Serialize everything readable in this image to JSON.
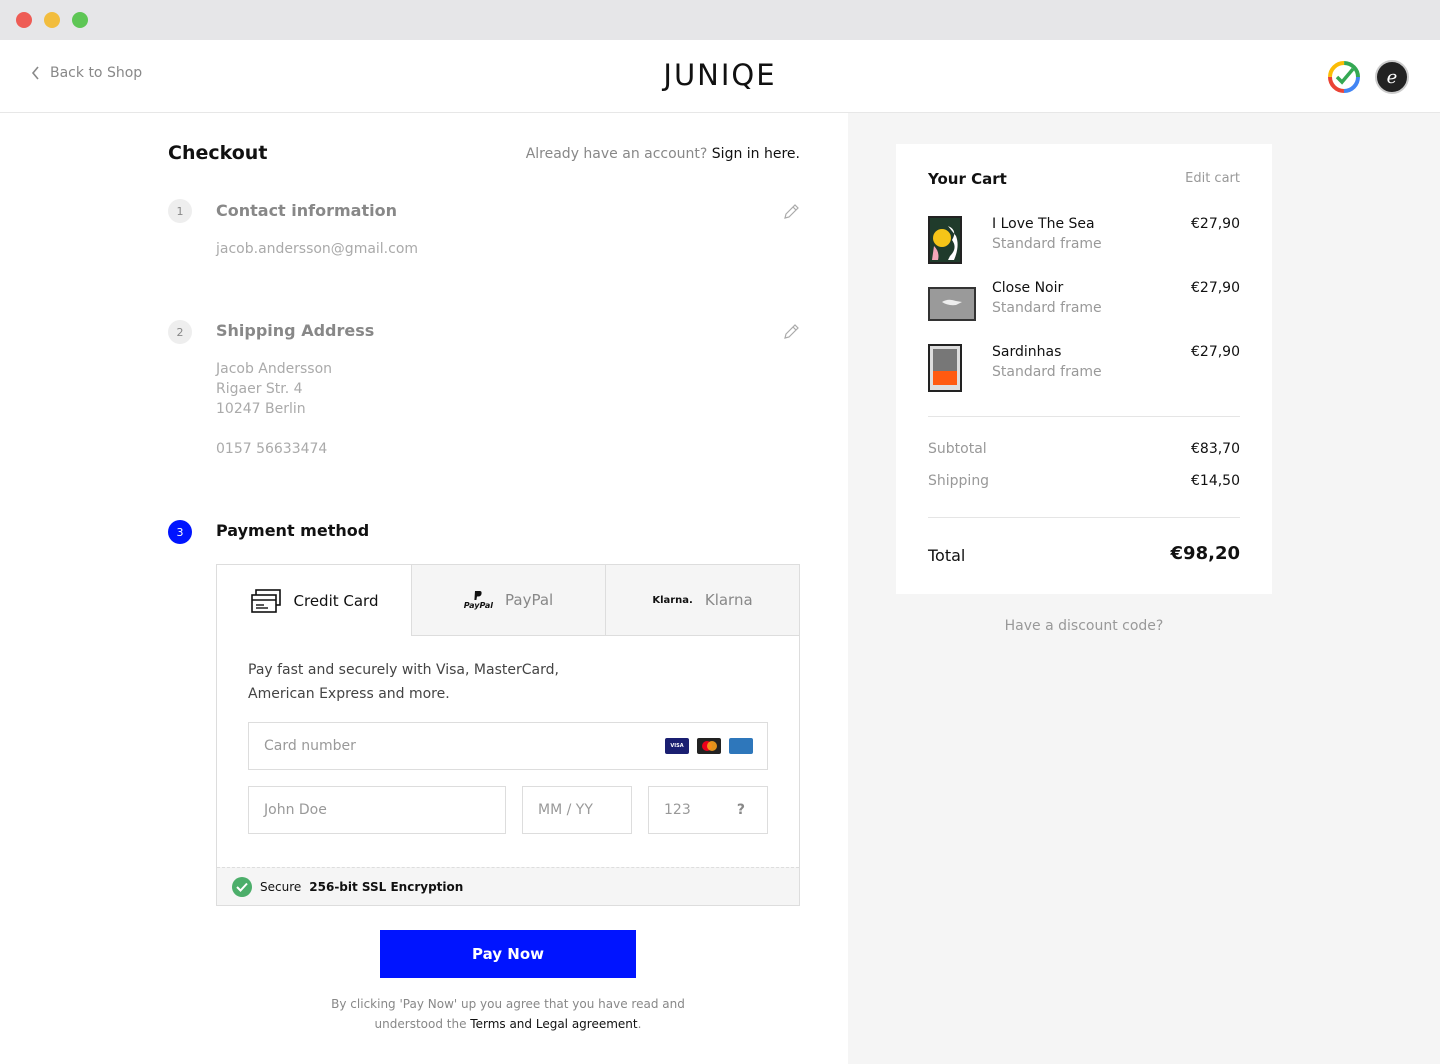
{
  "header": {
    "back_label": "Back to Shop",
    "logo_text": "JUNIQE"
  },
  "checkout": {
    "title": "Checkout",
    "account_prompt": "Already have an account?",
    "sign_in_link": "Sign in here."
  },
  "steps": [
    {
      "number": "1",
      "title": "Contact information",
      "lines": [
        "jacob.andersson@gmail.com"
      ]
    },
    {
      "number": "2",
      "title": "Shipping Address",
      "lines": [
        "Jacob  Andersson",
        "Rigaer Str. 4",
        "10247 Berlin",
        "0157 56633474"
      ]
    },
    {
      "number": "3",
      "title": "Payment method"
    }
  ],
  "payment": {
    "tabs": [
      {
        "label": "Credit Card",
        "active": true
      },
      {
        "label": "PayPal",
        "logo": "PayPal"
      },
      {
        "label": "Klarna",
        "logo": "Klarna."
      }
    ],
    "description": "Pay fast and securely with Visa, MasterCard, American Express and more.",
    "fields": {
      "card_number_placeholder": "Card number",
      "name_placeholder": "John Doe",
      "expiry_placeholder": "MM / YY",
      "cvc_placeholder": "123",
      "cvc_help": "?"
    },
    "card_icons": [
      "visa-icon",
      "mastercard-icon",
      "amex-icon"
    ],
    "visa_text": "VISA",
    "secure_prefix": "Secure",
    "secure_strong": "256-bit SSL Encryption",
    "pay_button": "Pay Now",
    "legal_text": "By clicking 'Pay Now' up you agree that you have read and understood the",
    "legal_link": "Terms and Legal agreement",
    "legal_end": "."
  },
  "cart": {
    "title": "Your Cart",
    "edit_label": "Edit cart",
    "items": [
      {
        "name": "I Love The Sea",
        "variant": "Standard frame",
        "price": "€27,90"
      },
      {
        "name": "Close Noir",
        "variant": "Standard frame",
        "price": "€27,90"
      },
      {
        "name": "Sardinhas",
        "variant": "Standard frame",
        "price": "€27,90"
      }
    ],
    "subtotal_label": "Subtotal",
    "subtotal_value": "€83,70",
    "shipping_label": "Shipping",
    "shipping_value": "€14,50",
    "total_label": "Total",
    "total_value": "€98,20",
    "discount_label": "Have a discount code?"
  },
  "colors": {
    "accent": "#0014ff",
    "success": "#4cae6a"
  }
}
